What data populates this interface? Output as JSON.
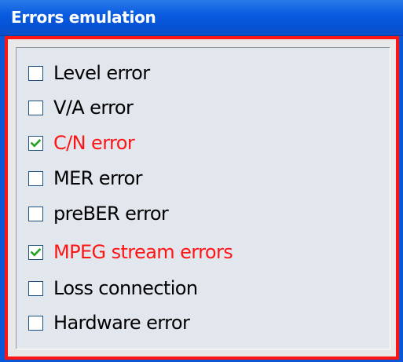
{
  "window": {
    "title": "Errors emulation"
  },
  "options": [
    {
      "label": "Level error",
      "checked": false
    },
    {
      "label": "V/A error",
      "checked": false
    },
    {
      "label": "C/N error",
      "checked": true
    },
    {
      "label": "MER error",
      "checked": false
    },
    {
      "label": "preBER error",
      "checked": false
    },
    {
      "label": "MPEG stream errors",
      "checked": true
    },
    {
      "label": "Loss connection",
      "checked": false
    },
    {
      "label": "Hardware error",
      "checked": false
    }
  ],
  "colors": {
    "title_bar": "#0653d6",
    "title_text": "#ffffff",
    "highlight_border": "#ff1414",
    "checked_label": "#ff1414",
    "checkmark": "#21a121",
    "panel_background": "#e2e7ee"
  }
}
